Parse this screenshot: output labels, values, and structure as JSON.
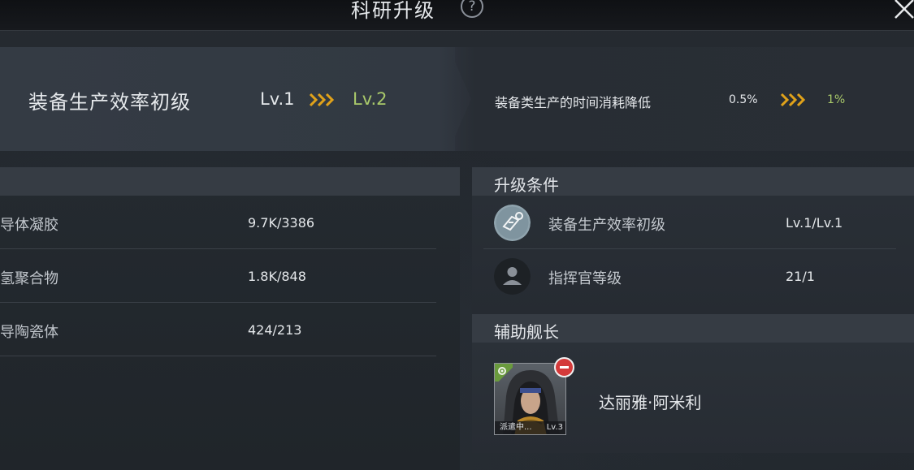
{
  "window": {
    "title": "科研升级",
    "help_icon": "question-icon",
    "close_icon": "close-icon"
  },
  "upgrade": {
    "tech_name": "装备生产效率初级",
    "level_from": "Lv.1",
    "level_to": "Lv.2",
    "effect_name": "装备类生产的时间消耗降低",
    "effect_from": "0.5%",
    "effect_to": "1%"
  },
  "resources": {
    "items": [
      {
        "label": "导体凝胶",
        "value": "9.7K/3386"
      },
      {
        "label": "氢聚合物",
        "value": "1.8K/848"
      },
      {
        "label": "导陶瓷体",
        "value": "424/213"
      }
    ]
  },
  "conditions": {
    "title": "升级条件",
    "items": [
      {
        "icon": "tech-chip-icon",
        "label": "装备生产效率初级",
        "value": "Lv.1/Lv.1"
      },
      {
        "icon": "commander-icon",
        "label": "指挥官等级",
        "value": "21/1"
      }
    ]
  },
  "assist": {
    "title": "辅助舰长",
    "captain": {
      "name": "达丽雅·阿米利",
      "status": "派遣中...",
      "level": "Lv.3"
    }
  },
  "colors": {
    "accent_green": "#a9c96a",
    "arrow_orange": "#e0a21a",
    "remove_red": "#d43a3a"
  }
}
